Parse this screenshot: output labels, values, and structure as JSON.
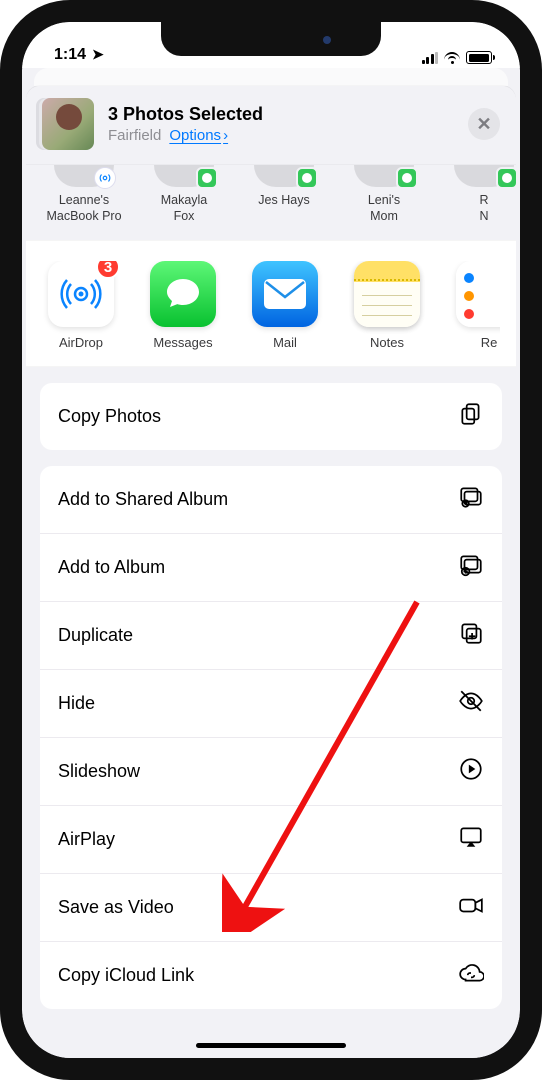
{
  "status": {
    "time": "1:14"
  },
  "header": {
    "title": "3 Photos Selected",
    "location": "Fairfield",
    "options_label": "Options"
  },
  "contacts": [
    {
      "name_line1": "Leanne's",
      "name_line2": "MacBook Pro",
      "badge": "airdrop"
    },
    {
      "name_line1": "Makayla",
      "name_line2": "Fox",
      "badge": "messages"
    },
    {
      "name_line1": "Jes Hays",
      "name_line2": "",
      "badge": "messages"
    },
    {
      "name_line1": "Leni's",
      "name_line2": "Mom",
      "badge": "messages"
    },
    {
      "name_line1": "R",
      "name_line2": "N",
      "badge": "messages"
    }
  ],
  "apps": [
    {
      "label": "AirDrop",
      "icon": "airdrop",
      "badge": "3"
    },
    {
      "label": "Messages",
      "icon": "messages",
      "badge": ""
    },
    {
      "label": "Mail",
      "icon": "mail",
      "badge": ""
    },
    {
      "label": "Notes",
      "icon": "notes",
      "badge": ""
    },
    {
      "label": "Re",
      "icon": "reminders",
      "badge": ""
    }
  ],
  "group1": [
    {
      "label": "Copy Photos",
      "icon": "copy"
    }
  ],
  "group2": [
    {
      "label": "Add to Shared Album",
      "icon": "shared-album"
    },
    {
      "label": "Add to Album",
      "icon": "album-add"
    },
    {
      "label": "Duplicate",
      "icon": "duplicate"
    },
    {
      "label": "Hide",
      "icon": "hide"
    },
    {
      "label": "Slideshow",
      "icon": "play-circle"
    },
    {
      "label": "AirPlay",
      "icon": "airplay"
    },
    {
      "label": "Save as Video",
      "icon": "video"
    },
    {
      "label": "Copy iCloud Link",
      "icon": "cloud-link"
    }
  ]
}
